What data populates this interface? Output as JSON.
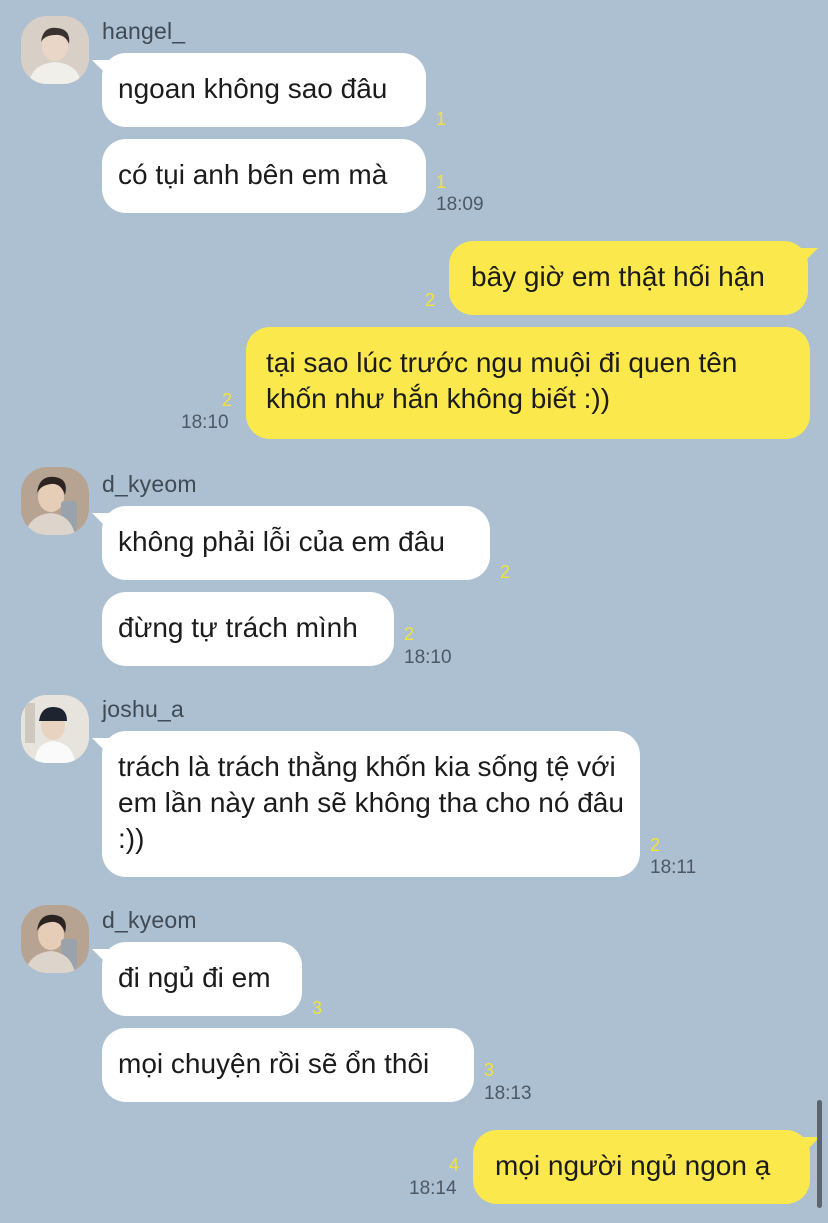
{
  "messages": [
    {
      "sender": "hangel_",
      "text": "ngoan không sao đâu",
      "unread": "1"
    },
    {
      "text": "có tụi anh bên em mà",
      "unread": "1",
      "time": "18:09"
    },
    {
      "text": "bây giờ em thật hối hận",
      "unread": "2"
    },
    {
      "text": "tại sao lúc trước ngu muội đi quen tên khốn như hắn không biết :))",
      "unread": "2",
      "time": "18:10"
    },
    {
      "sender": "d_kyeom",
      "text": "không phải lỗi của em đâu",
      "unread": "2"
    },
    {
      "text": "đừng tự trách mình",
      "unread": "2",
      "time": "18:10"
    },
    {
      "sender": "joshu_a",
      "text": "trách là trách thằng khốn kia sống tệ với em lần này anh sẽ không tha cho nó đâu :))",
      "unread": "2",
      "time": "18:11"
    },
    {
      "sender": "d_kyeom",
      "text": "đi ngủ đi em",
      "unread": "3"
    },
    {
      "text": "mọi chuyện rồi sẽ ổn thôi",
      "unread": "3",
      "time": "18:13"
    },
    {
      "text": "mọi người ngủ ngon ạ",
      "unread": "4",
      "time": "18:14"
    }
  ],
  "colors": {
    "background": "#adc0d1",
    "incoming_bubble": "#ffffff",
    "outgoing_bubble": "#fbe84c",
    "unread_count": "#f2e23a"
  }
}
